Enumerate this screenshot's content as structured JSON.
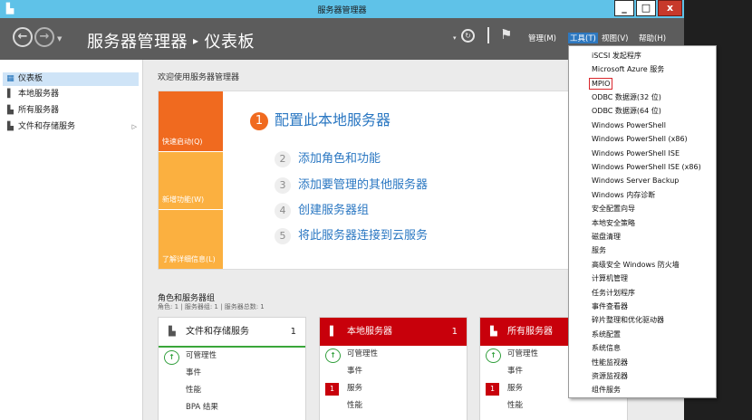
{
  "window": {
    "title": "服务器管理器",
    "controls": {
      "minimize": "_",
      "maximize": "□",
      "close": "x"
    }
  },
  "header": {
    "breadcrumb_app": "服务器管理器",
    "breadcrumb_sep": "▸",
    "breadcrumb_page": "仪表板",
    "menus": [
      "管理(M)",
      "工具(T)",
      "视图(V)",
      "帮助(H)"
    ],
    "active_menu": "工具(T)"
  },
  "sidebar": {
    "items": [
      {
        "label": "仪表板",
        "icon": "dashboard-grid-icon",
        "active": true
      },
      {
        "label": "本地服务器",
        "icon": "server-icon",
        "active": false
      },
      {
        "label": "所有服务器",
        "icon": "servers-icon",
        "active": false
      },
      {
        "label": "文件和存储服务",
        "icon": "storage-icon",
        "active": false,
        "expandable": true
      }
    ]
  },
  "main": {
    "welcome": "欢迎使用服务器管理器",
    "tiles": [
      "快速启动(Q)",
      "新增功能(W)",
      "了解详细信息(L)"
    ],
    "steps": [
      {
        "num": "1",
        "label": "配置此本地服务器"
      },
      {
        "num": "2",
        "label": "添加角色和功能"
      },
      {
        "num": "3",
        "label": "添加要管理的其他服务器"
      },
      {
        "num": "4",
        "label": "创建服务器组"
      },
      {
        "num": "5",
        "label": "将此服务器连接到云服务"
      }
    ],
    "roles_title": "角色和服务器组",
    "roles_sub": "角色: 1 | 服务器组: 1 | 服务器总数: 1",
    "cards": [
      {
        "title": "文件和存储服务",
        "count": "1",
        "rows": [
          "可管理性",
          "事件",
          "性能",
          "BPA 结果"
        ]
      },
      {
        "title": "本地服务器",
        "count": "1",
        "rows": [
          "可管理性",
          "事件",
          "服务",
          "性能"
        ],
        "services_badge": "1"
      },
      {
        "title": "所有服务器",
        "count": "",
        "rows": [
          "可管理性",
          "事件",
          "服务",
          "性能"
        ],
        "services_badge": "1"
      }
    ]
  },
  "tools_menu": {
    "items": [
      "iSCSI 发起程序",
      "Microsoft Azure 服务",
      "MPIO",
      "ODBC 数据源(32 位)",
      "ODBC 数据源(64 位)",
      "Windows PowerShell",
      "Windows PowerShell (x86)",
      "Windows PowerShell ISE",
      "Windows PowerShell ISE (x86)",
      "Windows Server Backup",
      "Windows 内存诊断",
      "安全配置向导",
      "本地安全策略",
      "磁盘清理",
      "服务",
      "高级安全 Windows 防火墙",
      "计算机管理",
      "任务计划程序",
      "事件查看器",
      "碎片整理和优化驱动器",
      "系统配置",
      "系统信息",
      "性能监视器",
      "资源监视器",
      "组件服务"
    ],
    "highlighted": "MPIO"
  },
  "colors": {
    "titlebar": "#5fc2e8",
    "header": "#5c5c5c",
    "accent_orange": "#f06a1f",
    "tile_yellow": "#fbb040",
    "card_red": "#c8000b",
    "link_blue": "#2a77c2"
  }
}
